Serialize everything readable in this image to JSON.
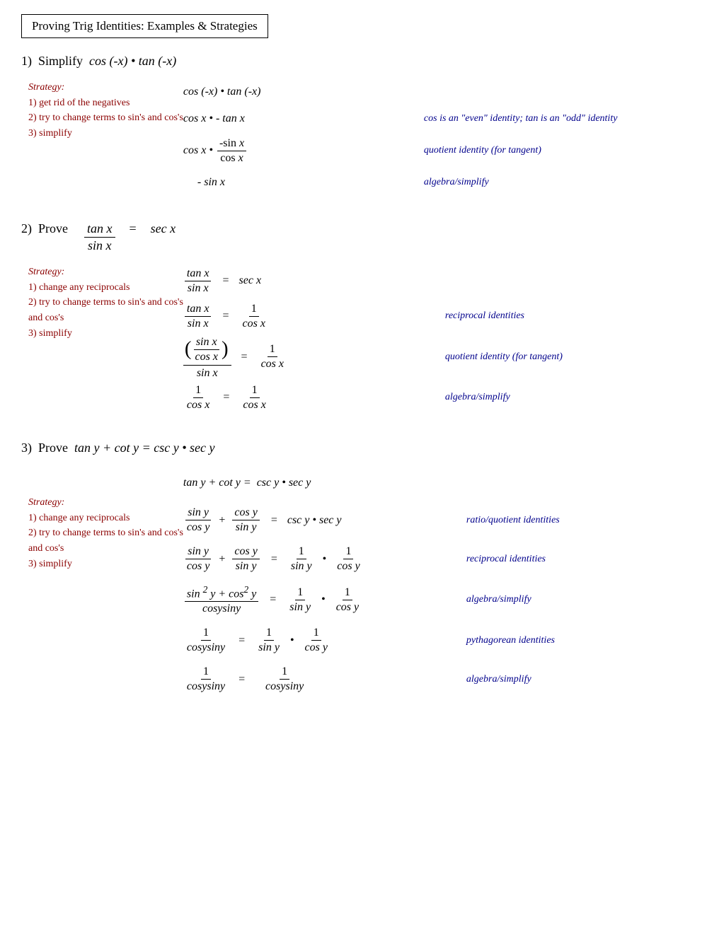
{
  "title": "Proving Trig Identities: Examples & Strategies",
  "problems": [
    {
      "number": "1)",
      "heading": "Simplify  cos (-x) • tan (-x)",
      "strategy": {
        "label": "Strategy:",
        "steps": [
          "1) get rid of the negatives",
          "2) try to change terms to sin's and cos's",
          "3) simplify"
        ]
      }
    },
    {
      "number": "2)",
      "heading_prefix": "Prove",
      "strategy": {
        "label": "Strategy:",
        "steps": [
          "1) change any reciprocals",
          "2) try to change terms to sin's and cos's",
          "3) simplify"
        ]
      }
    },
    {
      "number": "3)",
      "heading": "Prove  tan y + cot y =  csc y • sec y",
      "strategy": {
        "label": "Strategy:",
        "steps": [
          "1) change any reciprocals",
          "2) try to change terms to sin's and cos's",
          "3) simplify"
        ]
      }
    }
  ],
  "annotations": {
    "even_odd": "cos is an \"even\" identity;  tan is an \"odd\" identity",
    "quotient_tan": "quotient identity (for tangent)",
    "algebra_simplify": "algebra/simplify",
    "reciprocal": "reciprocal identities",
    "ratio_quotient": "ratio/quotient identities",
    "pythagorean": "pythagorean identities"
  }
}
